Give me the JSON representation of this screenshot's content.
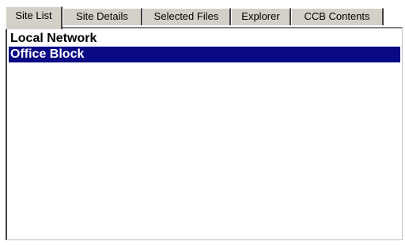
{
  "tabs": [
    {
      "label": "Site List",
      "active": true
    },
    {
      "label": "Site Details",
      "active": false
    },
    {
      "label": "Selected Files",
      "active": false
    },
    {
      "label": "Explorer",
      "active": false
    },
    {
      "label": "CCB Contents",
      "active": false
    }
  ],
  "site_list": {
    "items": [
      {
        "label": "Local Network",
        "selected": false
      },
      {
        "label": "Office Block",
        "selected": true
      }
    ]
  },
  "colors": {
    "selection_background": "#0a0a84",
    "selection_text": "#ffffff",
    "tab_face": "#d4d0c8"
  }
}
